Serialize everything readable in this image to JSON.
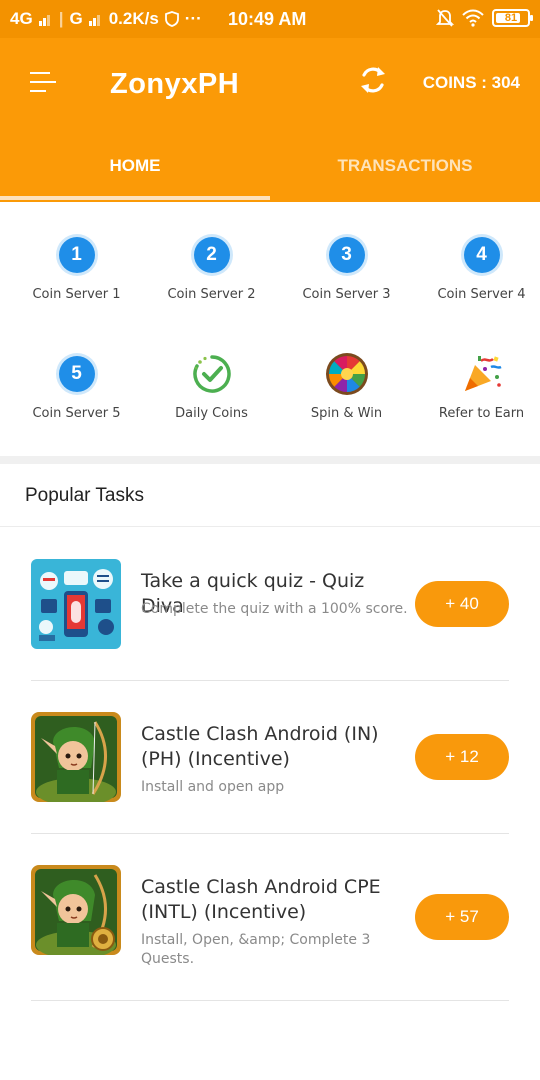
{
  "status_bar": {
    "network1": "4G",
    "network2": "G",
    "speed": "0.2K/s",
    "dots": "···",
    "time": "10:49 AM",
    "battery": "81",
    "battery_level": 0.81,
    "icons": [
      "signal-icon",
      "vpn-shield-icon",
      "mute-bell-icon",
      "wifi-icon",
      "battery-icon"
    ]
  },
  "app_bar": {
    "title": "ZonyxPH",
    "coins_label": "COINS : 304",
    "menu_icon": "hamburger-menu-icon",
    "sync_icon": "sync-icon",
    "background": "#fb9a07"
  },
  "tabs": [
    {
      "label": "HOME",
      "active": true
    },
    {
      "label": "TRANSACTIONS",
      "active": false
    }
  ],
  "grid_items": [
    {
      "number": "1",
      "label": "Coin Server 1"
    },
    {
      "number": "2",
      "label": "Coin Server 2"
    },
    {
      "number": "3",
      "label": "Coin Server 3"
    },
    {
      "number": "4",
      "label": "Coin Server 4"
    },
    {
      "number": "5",
      "label": "Coin Server 5"
    },
    {
      "icon": "daily-check-icon",
      "label": "Daily Coins"
    },
    {
      "icon": "spin-wheel-icon",
      "label": "Spin & Win"
    },
    {
      "icon": "party-popper-icon",
      "label": "Refer to Earn"
    }
  ],
  "section": {
    "title": "Popular Tasks"
  },
  "tasks": [
    {
      "title": "Take a quick quiz - Quiz Diva",
      "subtitle": "Complete the quiz with a 100% score.",
      "reward": "+ 40",
      "thumb": "quiz-app-icon"
    },
    {
      "title": "Castle Clash Android (IN) (PH) (Incentive)",
      "subtitle": "Install and open app",
      "reward": "+ 12",
      "thumb": "castle-clash-game-icon"
    },
    {
      "title": "Castle Clash Android CPE (INTL) (Incentive)",
      "subtitle": "Install, Open, &amp; Complete 3 Quests.",
      "reward": "+ 57",
      "thumb": "castle-clash-game-icon"
    }
  ],
  "colors": {
    "accent": "#fb9a07",
    "status_bar": "#f39200",
    "reward_button": "#f9990c",
    "server_badge": "#1f8ee8"
  }
}
